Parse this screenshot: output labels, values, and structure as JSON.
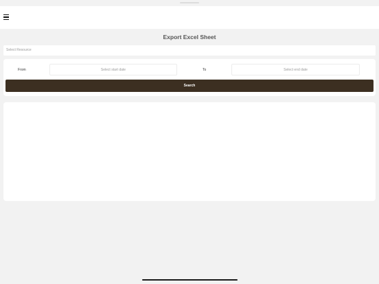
{
  "header": {
    "menu_icon": "hamburger-menu-icon"
  },
  "page": {
    "title": "Export Excel Sheet"
  },
  "resource": {
    "placeholder": "Select Resource"
  },
  "filters": {
    "from_label": "From",
    "start_date_placeholder": "Select start date",
    "to_label": "To",
    "end_date_placeholder": "Select end date"
  },
  "actions": {
    "search_label": "Search"
  },
  "colors": {
    "background": "#f2f2f2",
    "surface": "#ffffff",
    "primary_button": "#3c2f21",
    "placeholder_text": "#9a9a9a"
  }
}
